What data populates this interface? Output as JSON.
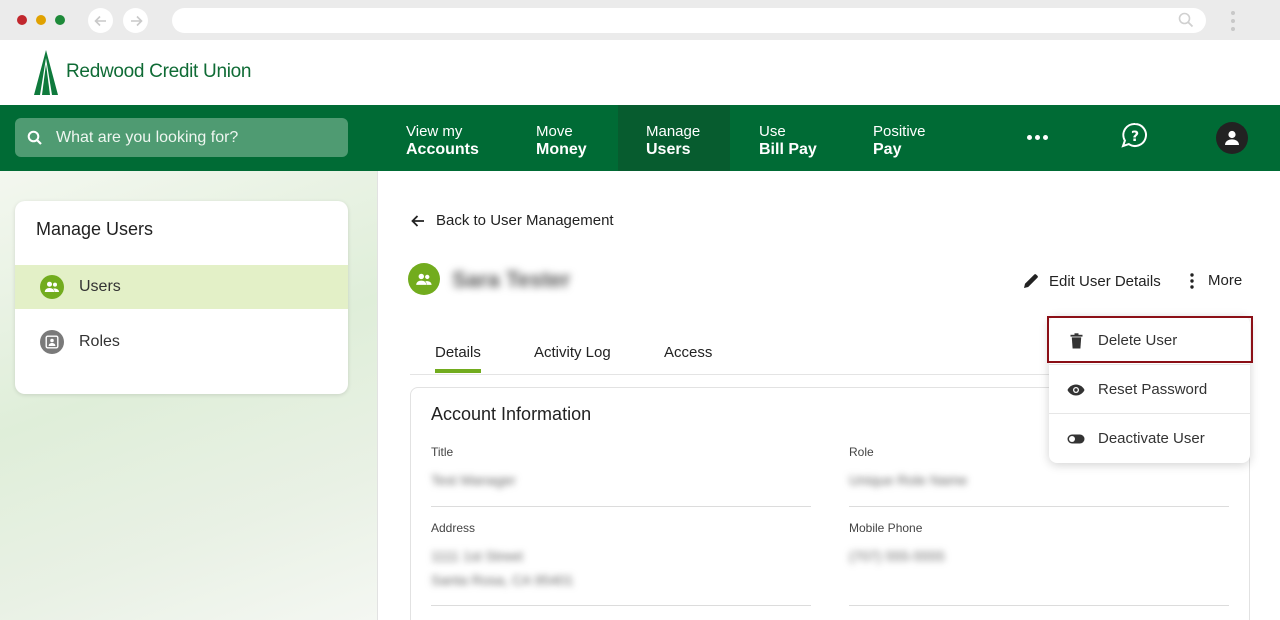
{
  "browser": {},
  "brand": {
    "name": "Redwood Credit Union",
    "color": "#006b35"
  },
  "search": {
    "placeholder": "What are you looking for?"
  },
  "nav": {
    "items": [
      {
        "line1": "View my",
        "line2": "Accounts"
      },
      {
        "line1": "Move",
        "line2": "Money"
      },
      {
        "line1": "Manage",
        "line2": "Users"
      },
      {
        "line1": "Use",
        "line2": "Bill Pay"
      },
      {
        "line1": "Positive",
        "line2": "Pay"
      }
    ],
    "active_index": 2
  },
  "sidebar": {
    "title": "Manage Users",
    "items": [
      {
        "label": "Users",
        "icon": "users-icon"
      },
      {
        "label": "Roles",
        "icon": "roles-icon"
      }
    ]
  },
  "main": {
    "back_label": "Back to User Management",
    "user_name": "Sara Tester",
    "edit_label": "Edit User Details",
    "more_label": "More",
    "tabs": [
      {
        "label": "Details"
      },
      {
        "label": "Activity Log"
      },
      {
        "label": "Access"
      }
    ],
    "account_info": {
      "title": "Account Information",
      "fields": {
        "title_label": "Title",
        "title_value": "Test Manager",
        "role_label": "Role",
        "role_value": "Unique Role Name",
        "address_label": "Address",
        "address_line1": "1111 1st Street",
        "address_line2": "Santa Rosa, CA 95401",
        "phone_label": "Mobile Phone",
        "phone_value": "(707) 555-5555"
      }
    }
  },
  "menu": {
    "items": [
      {
        "label": "Delete User",
        "icon": "trash-icon"
      },
      {
        "label": "Reset Password",
        "icon": "eye-icon"
      },
      {
        "label": "Deactivate User",
        "icon": "toggle-icon"
      }
    ],
    "highlight_color": "#8b0f16"
  }
}
